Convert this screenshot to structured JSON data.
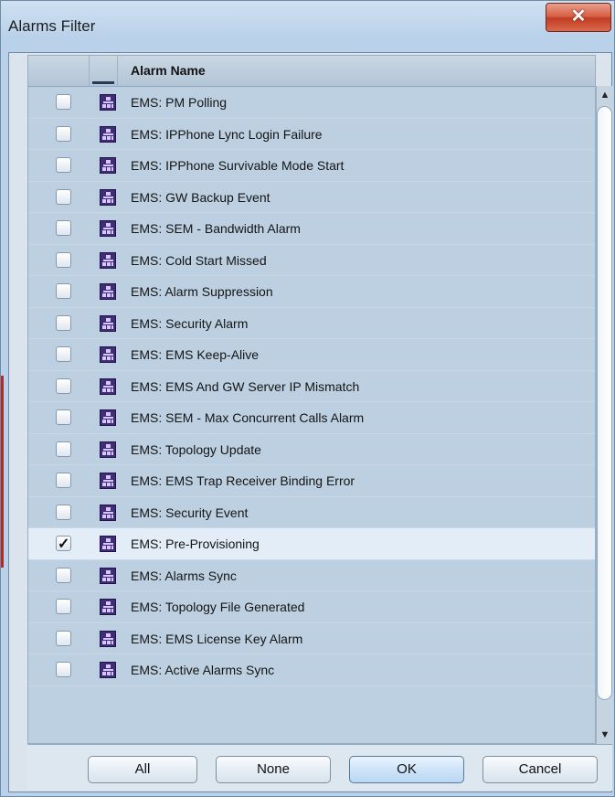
{
  "window": {
    "title": "Alarms Filter",
    "close_glyph": "✕"
  },
  "table": {
    "header": "Alarm Name",
    "rows": [
      {
        "label": "EMS: PM Polling",
        "checked": false
      },
      {
        "label": "EMS: IPPhone Lync Login Failure",
        "checked": false
      },
      {
        "label": "EMS: IPPhone Survivable Mode Start",
        "checked": false
      },
      {
        "label": "EMS: GW Backup Event",
        "checked": false
      },
      {
        "label": "EMS: SEM - Bandwidth Alarm",
        "checked": false
      },
      {
        "label": "EMS: Cold Start Missed",
        "checked": false
      },
      {
        "label": "EMS: Alarm Suppression",
        "checked": false
      },
      {
        "label": "EMS: Security Alarm",
        "checked": false
      },
      {
        "label": "EMS: EMS Keep-Alive",
        "checked": false
      },
      {
        "label": "EMS: EMS And GW Server IP Mismatch",
        "checked": false
      },
      {
        "label": "EMS: SEM - Max Concurrent Calls Alarm",
        "checked": false
      },
      {
        "label": "EMS: Topology Update",
        "checked": false
      },
      {
        "label": "EMS: EMS Trap Receiver Binding Error",
        "checked": false
      },
      {
        "label": "EMS: Security Event",
        "checked": false
      },
      {
        "label": "EMS: Pre-Provisioning",
        "checked": true
      },
      {
        "label": "EMS: Alarms Sync",
        "checked": false
      },
      {
        "label": "EMS: Topology File Generated",
        "checked": false
      },
      {
        "label": "EMS: EMS License Key Alarm",
        "checked": false
      },
      {
        "label": "EMS: Active Alarms Sync",
        "checked": false
      }
    ],
    "row_icon": "alarm-tree-icon"
  },
  "scroll": {
    "up_glyph": "▲",
    "down_glyph": "▼"
  },
  "buttons": {
    "all": "All",
    "none": "None",
    "ok": "OK",
    "cancel": "Cancel"
  },
  "colors": {
    "selected_row": "#e2edf8",
    "row": "#bdd0e1",
    "icon": "#3f2d78"
  }
}
